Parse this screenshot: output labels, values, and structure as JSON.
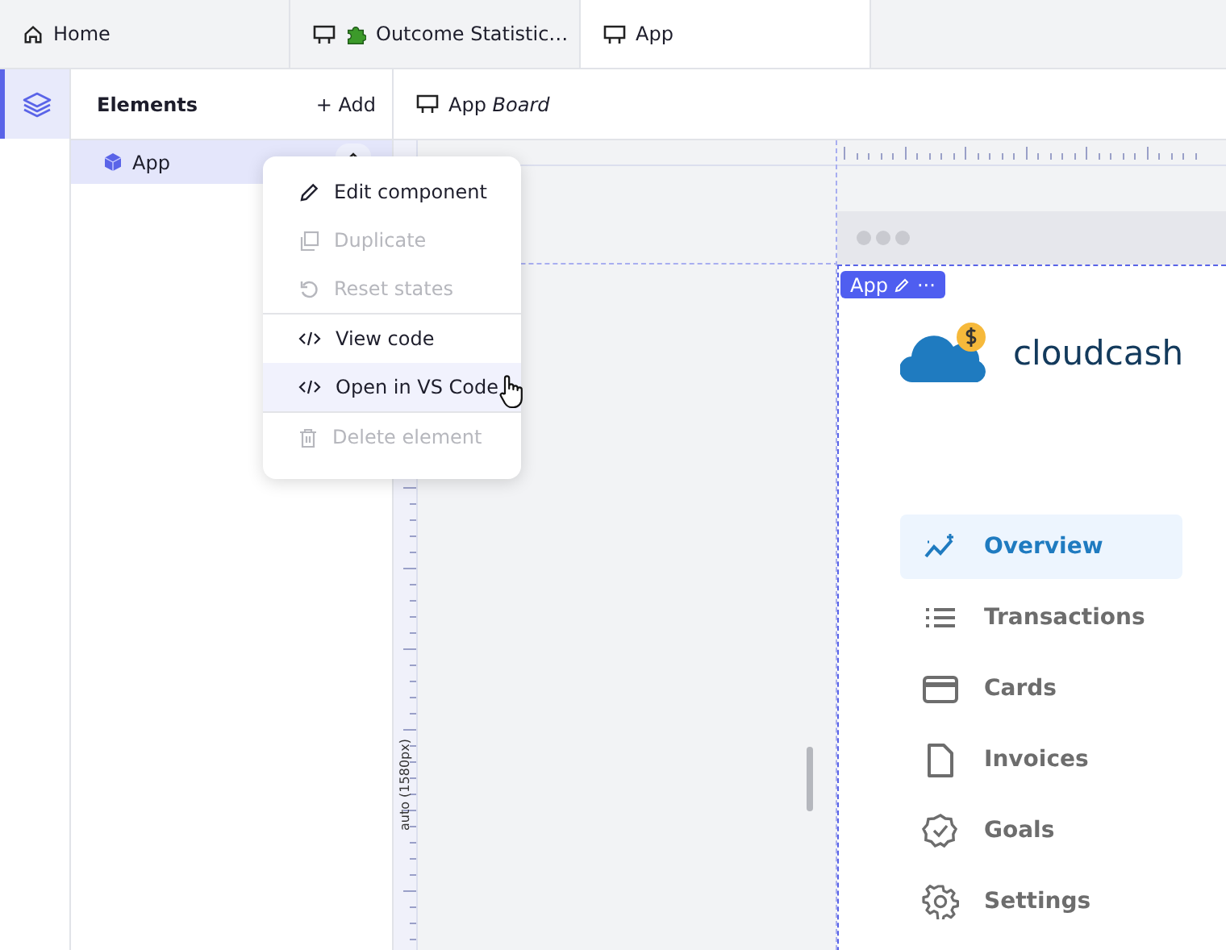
{
  "tabs": [
    {
      "label": "Home",
      "kind": "home",
      "selected": false
    },
    {
      "label": "Outcome Statistic…",
      "kind": "board-puzzle",
      "selected": false
    },
    {
      "label": "App",
      "kind": "board",
      "selected": true
    }
  ],
  "elements_panel": {
    "title": "Elements",
    "add_label": "+ Add",
    "items": [
      {
        "label": "App",
        "selected": true,
        "expanded": false
      }
    ]
  },
  "canvas": {
    "title": "App *Board*",
    "height_label": "auto (1580px)",
    "frame_badge": "App",
    "frame_badge_more": "···"
  },
  "context_menu": [
    {
      "kind": "edit",
      "label": "Edit component",
      "disabled": false,
      "selected": false
    },
    {
      "kind": "duplicate",
      "label": "Duplicate",
      "disabled": true,
      "selected": false
    },
    {
      "kind": "reset",
      "label": "Reset states",
      "disabled": true,
      "selected": false
    },
    {
      "kind": "code",
      "label": "View code",
      "disabled": false,
      "selected": false,
      "divider_before": true
    },
    {
      "kind": "code",
      "label": "Open in VS Code",
      "disabled": false,
      "selected": true
    },
    {
      "kind": "delete",
      "label": "Delete element",
      "disabled": true,
      "selected": false,
      "divider_before": true
    }
  ],
  "app": {
    "logo": "cloudcash",
    "nav": [
      {
        "kind": "overview",
        "label": "Overview",
        "selected": true
      },
      {
        "kind": "list",
        "label": "Transactions",
        "selected": false
      },
      {
        "kind": "card",
        "label": "Cards",
        "selected": false
      },
      {
        "kind": "doc",
        "label": "Invoices",
        "selected": false
      },
      {
        "kind": "badge",
        "label": "Goals",
        "selected": false
      },
      {
        "kind": "gear",
        "label": "Settings",
        "selected": false
      }
    ]
  }
}
